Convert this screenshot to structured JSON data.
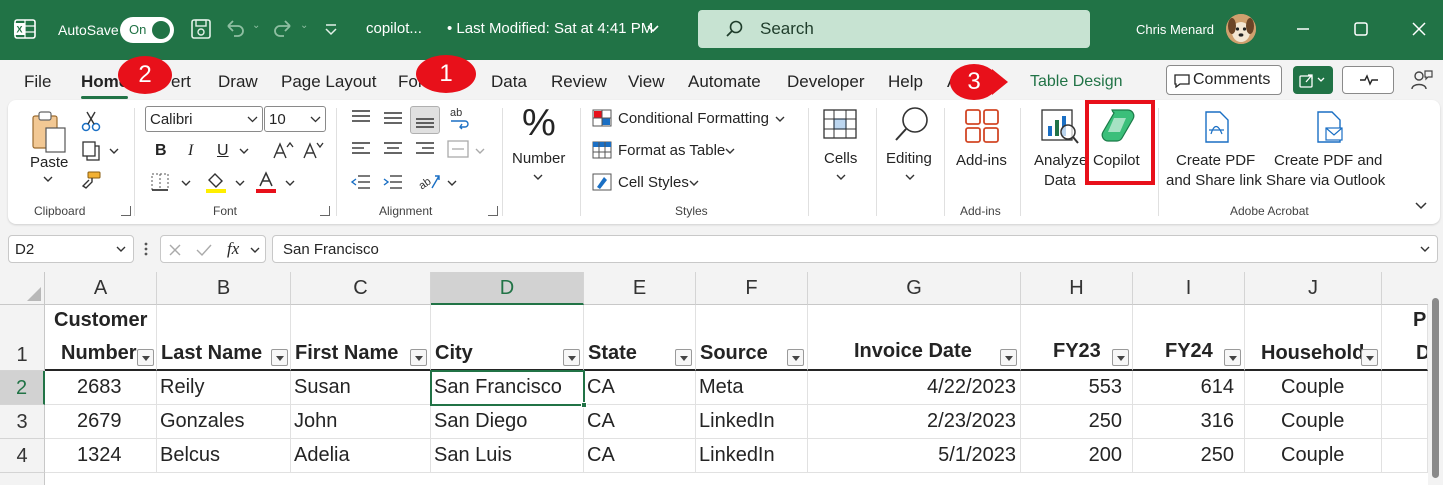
{
  "titlebar": {
    "autosave_label": "AutoSave",
    "autosave_state": "On",
    "doc_title": "copilot...",
    "doc_modified": "•  Last Modified: Sat at 4:41 PM",
    "search_placeholder": "Search",
    "user_name": "Chris Menard",
    "colors": {
      "brand": "#217346",
      "search_bg": "#c7e3d2"
    }
  },
  "tabs": {
    "items": [
      "File",
      "Home",
      "Insert",
      "Draw",
      "Page Layout",
      "Formulas",
      "Data",
      "Review",
      "View",
      "Automate",
      "Developer",
      "Help",
      "Acrobat",
      "Table Design"
    ],
    "active": "Home",
    "visible": {
      "file": "File",
      "home": "Home",
      "ert": "ert",
      "draw": "Draw",
      "page_layout": "Page Layout",
      "formulas": "For",
      "data": "Data",
      "review": "Review",
      "view": "View",
      "automate": "Automate",
      "developer": "Developer",
      "help": "Help",
      "acrobat": "A",
      "table_design": "Table Design"
    },
    "comments_label": "Comments"
  },
  "callouts": {
    "one": "1",
    "two": "2",
    "three": "3",
    "color": "#e8101a"
  },
  "ribbon": {
    "clipboard": {
      "label": "Clipboard",
      "paste": "Paste"
    },
    "font": {
      "label": "Font",
      "family": "Calibri",
      "size": "10",
      "bold": "B",
      "italic": "I",
      "underline": "U"
    },
    "alignment": {
      "label": "Alignment"
    },
    "number": {
      "label": "Number",
      "symbol": "%"
    },
    "styles": {
      "label": "Styles",
      "conditional": "Conditional Formatting",
      "format_table": "Format as Table",
      "cell_styles": "Cell Styles"
    },
    "cells": {
      "label": "Cells"
    },
    "editing": {
      "label": "Editing"
    },
    "addins": {
      "button": "Add-ins",
      "label": "Add-ins"
    },
    "analyze": {
      "line1": "Analyze",
      "line2": "Data"
    },
    "copilot": {
      "label": "Copilot"
    },
    "acrobat": {
      "label": "Adobe Acrobat",
      "pdf_link_1": "Create PDF",
      "pdf_link_2": "and Share link",
      "pdf_outlook_1": "Create PDF and",
      "pdf_outlook_2": "Share via Outlook"
    }
  },
  "formula_bar": {
    "name_box": "D2",
    "fx": "fx",
    "value": "San Francisco"
  },
  "grid": {
    "columns": [
      "A",
      "B",
      "C",
      "D",
      "E",
      "F",
      "G",
      "H",
      "I",
      "J"
    ],
    "rows": [
      "1",
      "2",
      "3",
      "4"
    ],
    "headers": {
      "a1": "Customer",
      "a2": "Number",
      "b": "Last Name",
      "c": "First Name",
      "d": "City",
      "e": "State",
      "f": "Source",
      "g": "Invoice Date",
      "h": "FY23",
      "i": "FY24",
      "j": "Household",
      "k1": "P",
      "k2": "D"
    },
    "data": [
      {
        "a": "2683",
        "b": "Reily",
        "c": "Susan",
        "d": "San Francisco",
        "e": "CA",
        "f": "Meta",
        "g": "4/22/2023",
        "h": "553",
        "i": "614",
        "j": "Couple"
      },
      {
        "a": "2679",
        "b": "Gonzales",
        "c": "John",
        "d": "San Diego",
        "e": "CA",
        "f": "LinkedIn",
        "g": "2/23/2023",
        "h": "250",
        "i": "316",
        "j": "Couple"
      },
      {
        "a": "1324",
        "b": "Belcus",
        "c": "Adelia",
        "d": "San Luis",
        "e": "CA",
        "f": "LinkedIn",
        "g": "5/1/2023",
        "h": "200",
        "i": "250",
        "j": "Couple"
      }
    ],
    "active_cell": "D2"
  }
}
